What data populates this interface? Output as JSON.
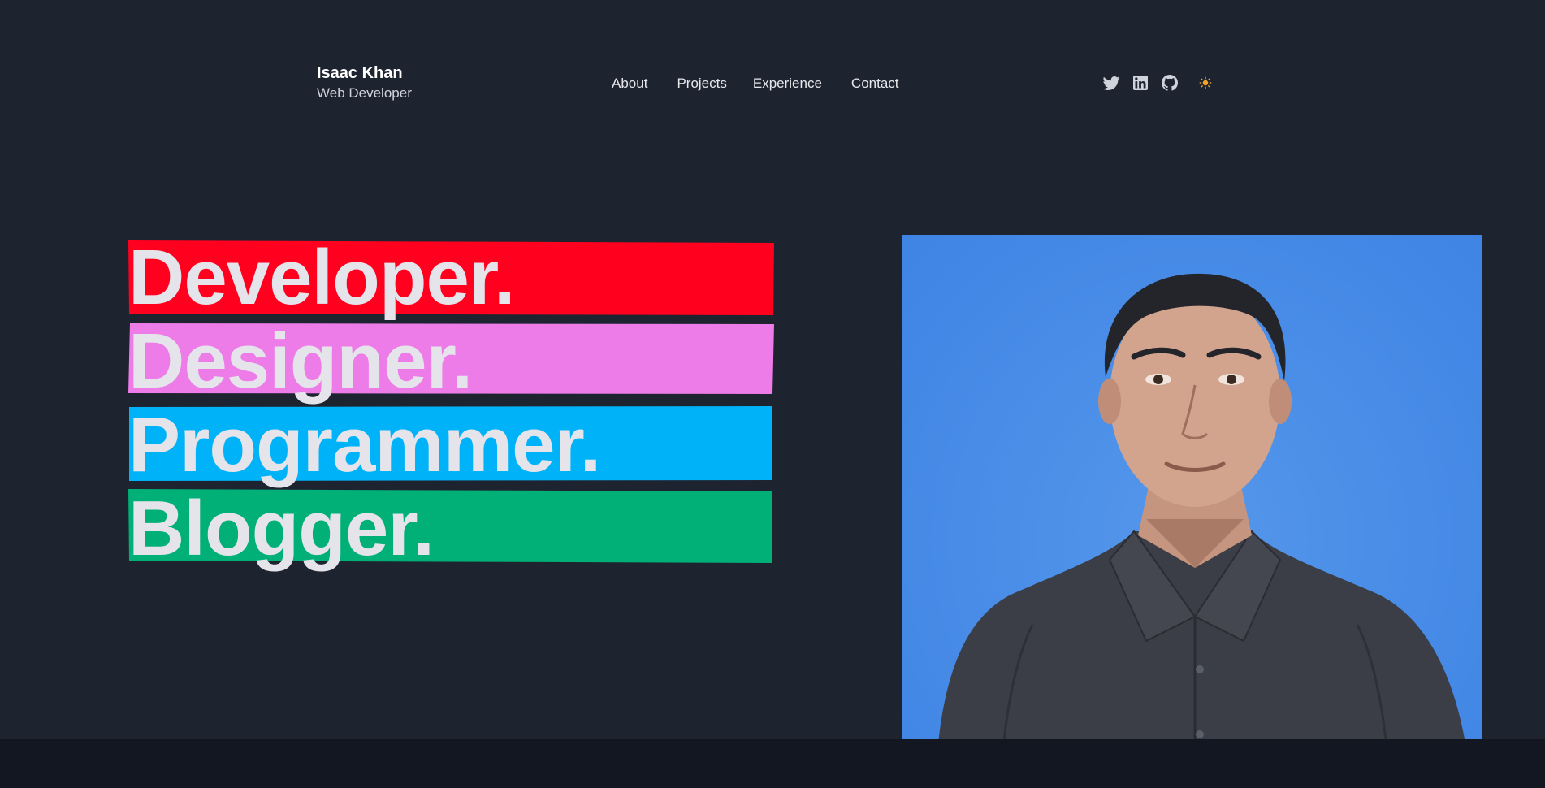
{
  "header": {
    "name": "Isaac Khan",
    "role": "Web Developer",
    "nav": [
      "About",
      "Projects",
      "Experience",
      "Contact"
    ],
    "social": [
      {
        "icon": "twitter-icon"
      },
      {
        "icon": "linkedin-icon"
      },
      {
        "icon": "github-icon"
      }
    ],
    "theme_toggle_icon": "sun-icon"
  },
  "hero": {
    "words": [
      {
        "text": "Developer.",
        "color": "#ff001f"
      },
      {
        "text": "Designer.",
        "color": "#ee7ce8"
      },
      {
        "text": "Programmer.",
        "color": "#00b2f7"
      },
      {
        "text": "Blogger.",
        "color": "#00b077"
      }
    ]
  },
  "portrait": {
    "background": "#4a8ee8"
  },
  "colors": {
    "background": "#1e2330",
    "footer_band": "#131722",
    "accent_sun": "#f5a623"
  }
}
